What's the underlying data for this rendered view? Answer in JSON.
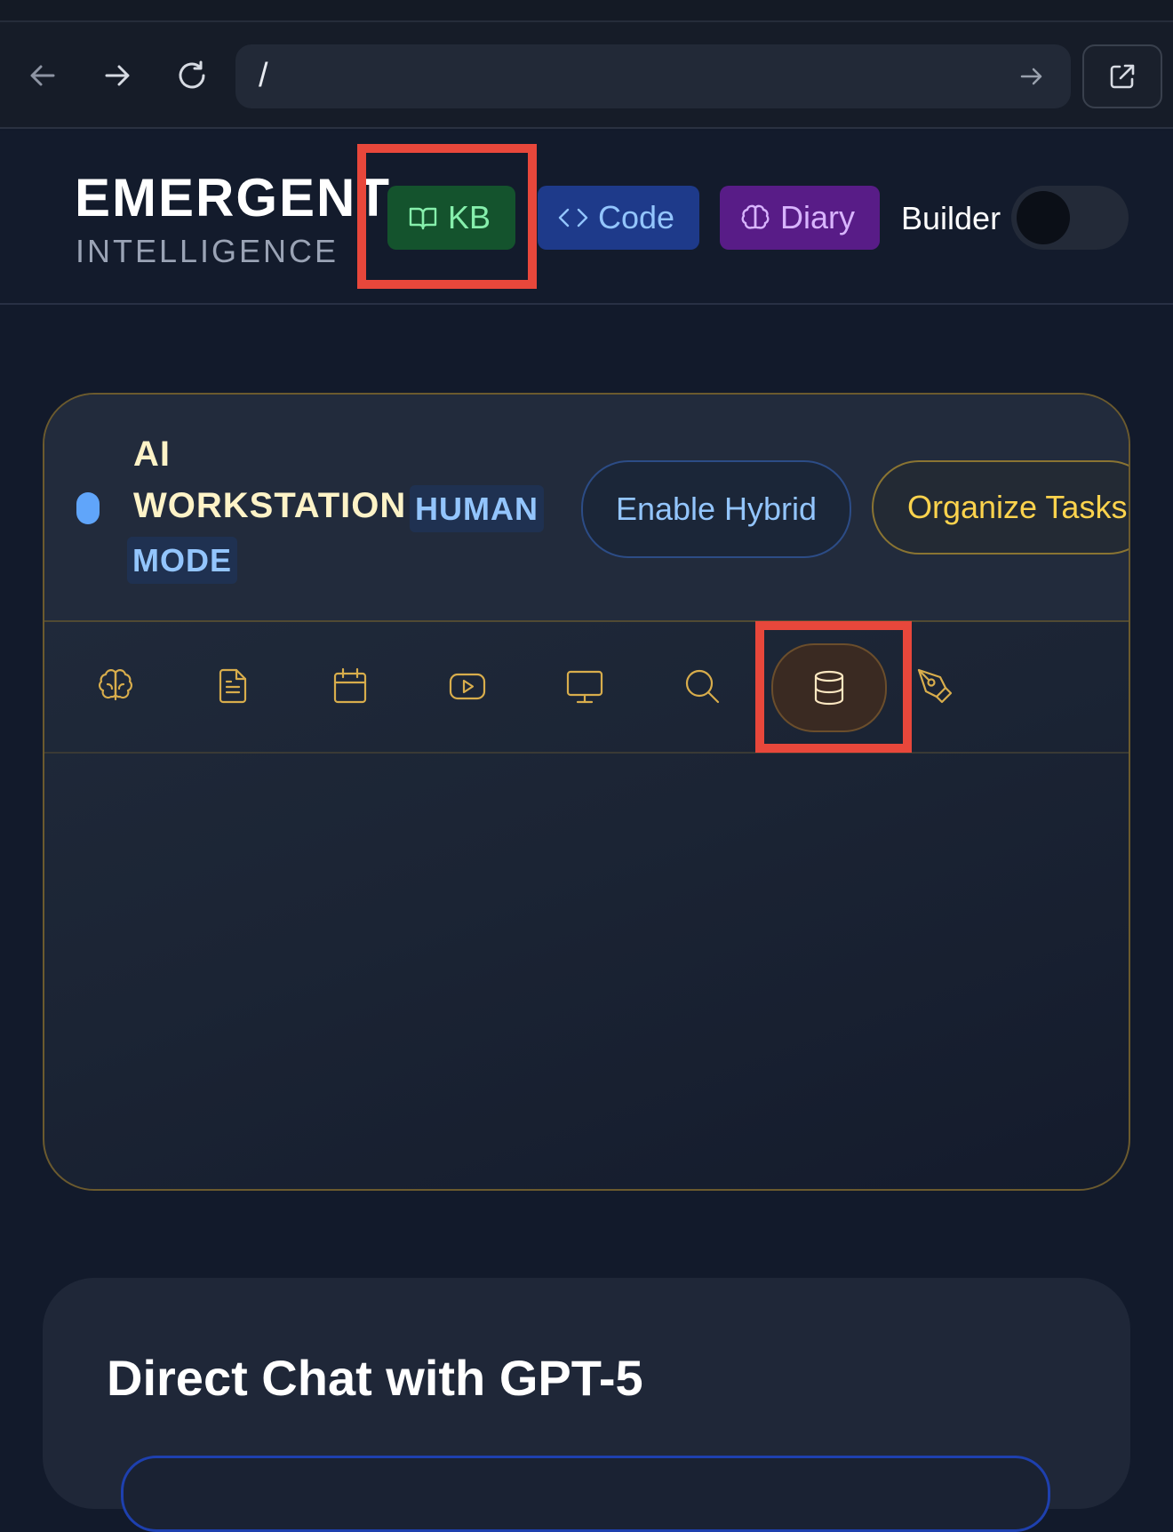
{
  "browser": {
    "url": "/",
    "icons": {
      "back": "arrow-left-icon",
      "forward": "arrow-right-icon",
      "reload": "reload-icon",
      "go": "arrow-right-icon",
      "open_external": "external-link-icon"
    }
  },
  "header": {
    "brand_title": "EMERGENT",
    "brand_subtitle": "INTELLIGENCE",
    "buttons": [
      {
        "label": "KB",
        "icon": "book-open-icon",
        "color": "#14532d"
      },
      {
        "label": "Code",
        "icon": "code-icon",
        "color": "#1e3a8a"
      },
      {
        "label": "Diary",
        "icon": "brain-icon",
        "color": "#581c87"
      }
    ],
    "builder_label": "Builder",
    "builder_toggle_on": false
  },
  "workstation": {
    "title": "AI WORKSTATION",
    "mode": "HUMAN MODE",
    "status_color": "#60a5fa",
    "enable_hybrid_label": "Enable Hybrid",
    "organize_tasks_label": "Organize Tasks",
    "tools": [
      {
        "name": "brain-icon",
        "active": false
      },
      {
        "name": "document-icon",
        "active": false
      },
      {
        "name": "calendar-icon",
        "active": false
      },
      {
        "name": "video-icon",
        "active": false
      },
      {
        "name": "monitor-icon",
        "active": false
      },
      {
        "name": "search-icon",
        "active": false
      },
      {
        "name": "database-icon",
        "active": true
      },
      {
        "name": "pen-tool-icon",
        "active": false
      }
    ]
  },
  "chat": {
    "title": "Direct Chat with GPT-5"
  },
  "colors": {
    "accent_gold": "#d8ad4c",
    "highlight_red": "#e8473b",
    "background": "#121a2b"
  }
}
